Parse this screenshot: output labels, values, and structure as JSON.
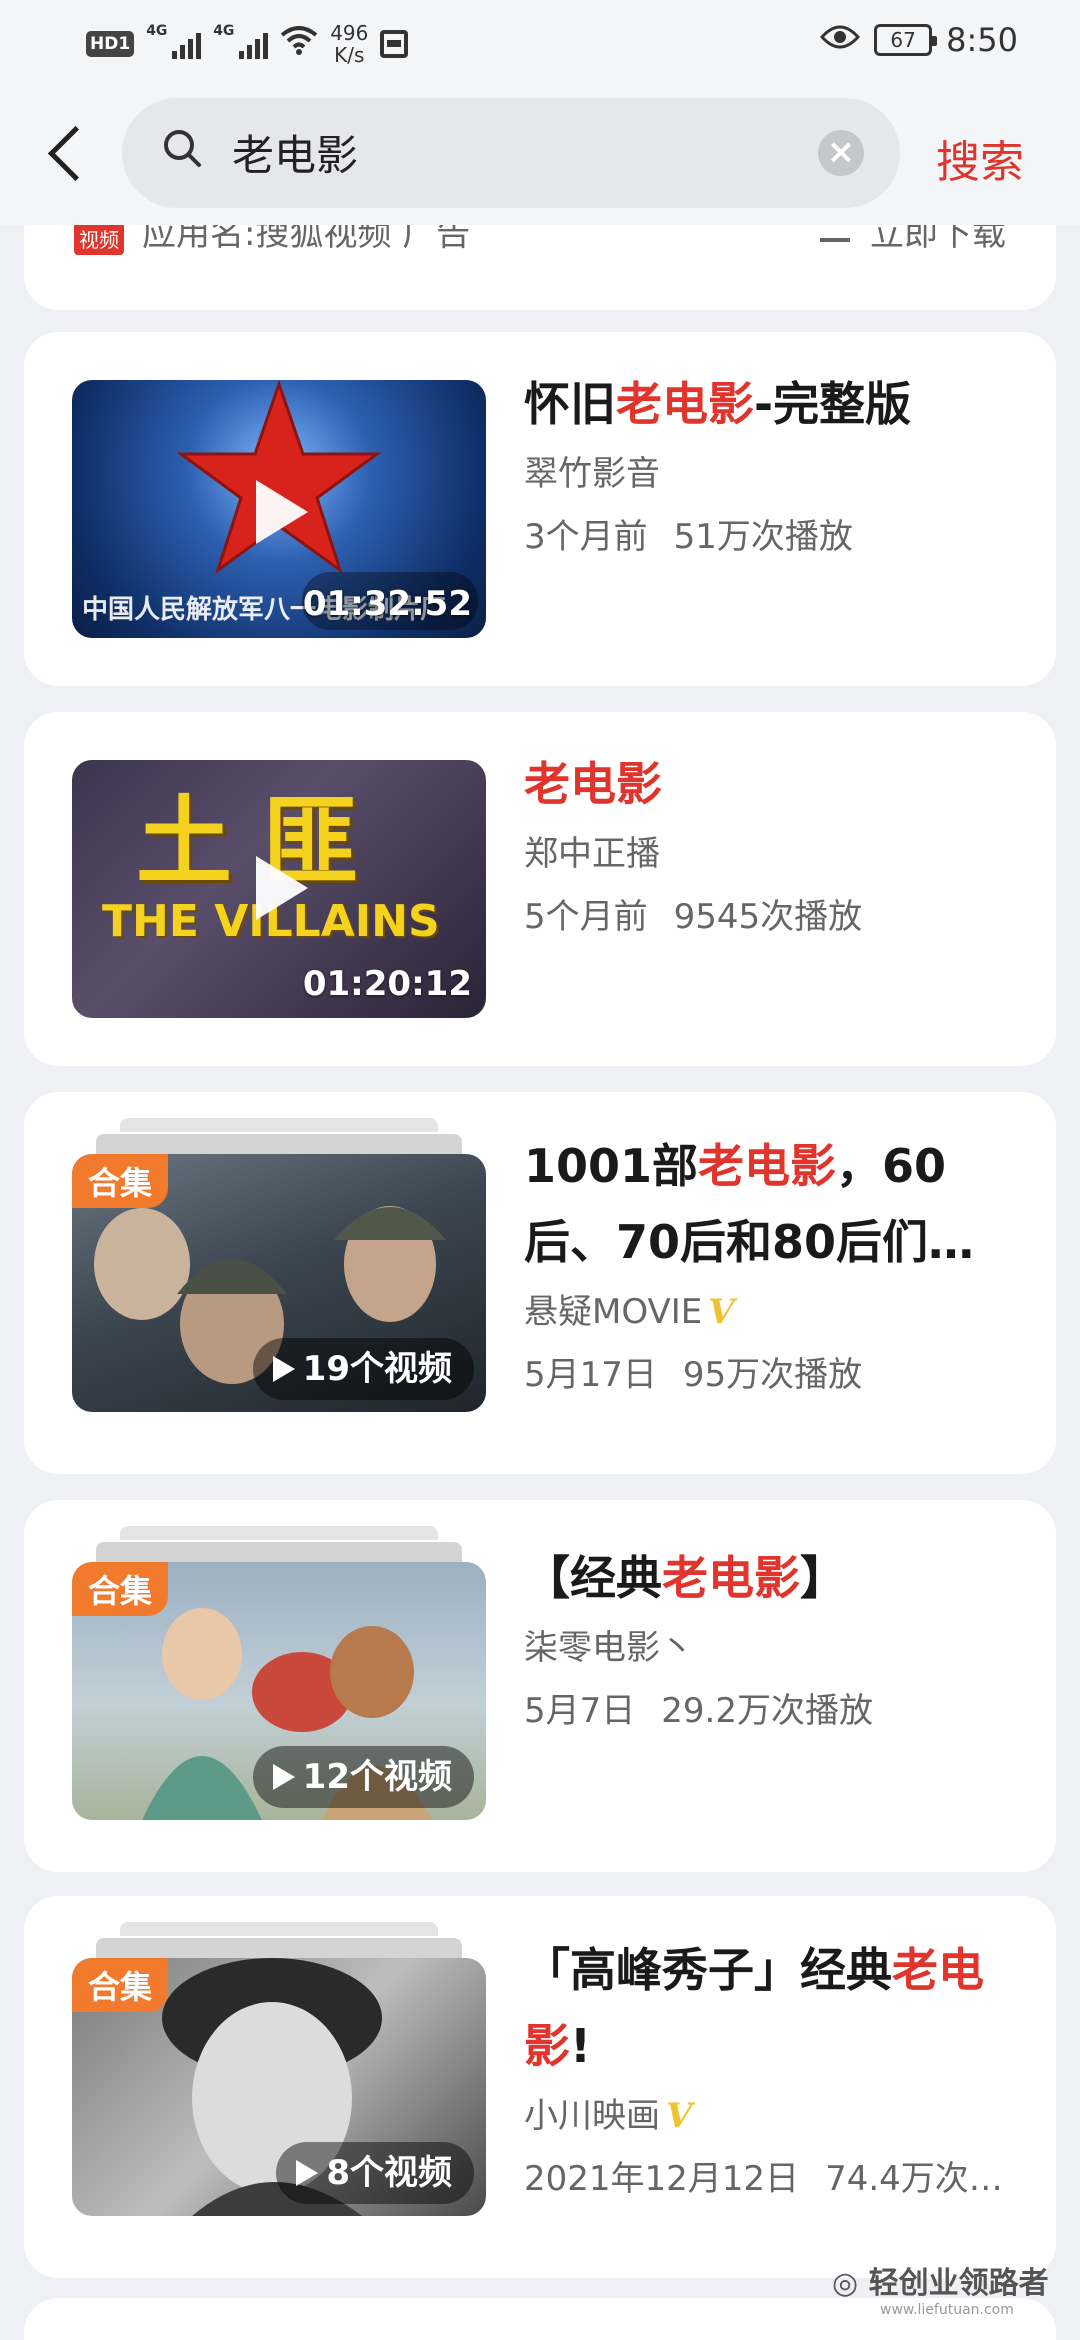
{
  "status_bar": {
    "hd": "HD",
    "hd_num": "1",
    "net1": "4G",
    "net2": "4G",
    "speed_value": "496",
    "speed_unit": "K/s",
    "battery": "67",
    "time": "8:50"
  },
  "search": {
    "query": "老电影",
    "button_label": "搜索"
  },
  "ad": {
    "badge": "视频",
    "text": "应用名:搜狐视频 广告",
    "download_label": "立即下载"
  },
  "results": [
    {
      "title_parts": [
        "怀旧",
        "老电影",
        "-完整版"
      ],
      "uploader": "翠竹影音",
      "time": "3个月前",
      "plays": "51万次播放",
      "duration": "01:32:52",
      "thumb_caption": "中国人民解放军八一电影制片厂"
    },
    {
      "title_parts": [
        "",
        "老电影",
        ""
      ],
      "uploader": "郑中正播",
      "time": "5个月前",
      "plays": "9545次播放",
      "duration": "01:20:12",
      "thumb_title_cn": "土匪",
      "thumb_title_en": "THE VILLAINS"
    },
    {
      "title_parts": [
        "1001部",
        "老电影",
        "，60后、70后和80后们…"
      ],
      "uploader": "悬疑MOVIE",
      "verified": "V",
      "time": "5月17日",
      "plays": "95万次播放",
      "badge": "合集",
      "video_count": "19个视频"
    },
    {
      "title_parts": [
        "【经典",
        "老电影",
        "】"
      ],
      "uploader": "柒零电影丶",
      "time": "5月7日",
      "plays": "29.2万次播放",
      "badge": "合集",
      "video_count": "12个视频"
    },
    {
      "title_parts": [
        "「高峰秀子」经典",
        "老电影",
        "!"
      ],
      "uploader": "小川映画",
      "verified": "V",
      "time": "2021年12月12日",
      "plays": "74.4万次…",
      "badge": "合集",
      "video_count": "8个视频"
    }
  ],
  "watermark": {
    "text": "轻创业领路者",
    "url": "www.liefutuan.com"
  },
  "colors": {
    "accent_red": "#e0342c",
    "collection_orange": "#f27a2c",
    "verified_gold": "#f1c232"
  }
}
